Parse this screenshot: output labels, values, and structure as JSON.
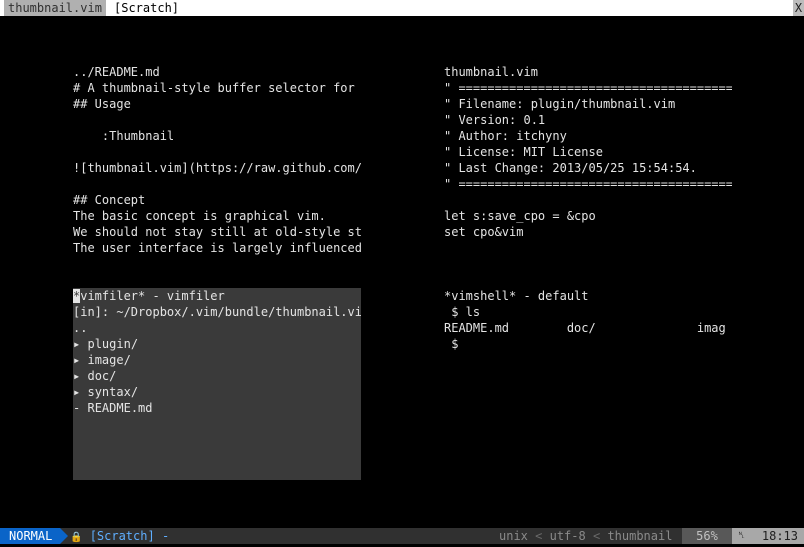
{
  "tabline": {
    "tabs": [
      {
        "label": "thumbnail.vim"
      },
      {
        "label": "[Scratch]"
      }
    ],
    "close_label": "X"
  },
  "thumbnails": [
    {
      "lines": [
        "../README.md",
        "# A thumbnail-style buffer selector for V",
        "## Usage",
        "",
        "    :Thumbnail",
        "",
        "![thumbnail.vim](https://raw.github.com/i",
        "",
        "## Concept",
        "The basic concept is graphical vim.",
        "We should not stay still at old-style sta",
        "The user interface is largely influenced"
      ]
    },
    {
      "lines": [
        "thumbnail.vim",
        "\" ======================================",
        "\" Filename: plugin/thumbnail.vim",
        "\" Version: 0.1",
        "\" Author: itchyny",
        "\" License: MIT License",
        "\" Last Change: 2013/05/25 15:54:54.",
        "\" ======================================",
        "",
        "let s:save_cpo = &cpo",
        "set cpo&vim"
      ]
    },
    {
      "cursor_char": "*",
      "first_line_rest": "vimfiler* - vimfiler",
      "lines": [
        "[in]: ~/Dropbox/.vim/bundle/thumbnail.vim",
        ".."
      ],
      "tree": [
        {
          "icon": "▸",
          "label": "plugin/"
        },
        {
          "icon": "▸",
          "label": "image/"
        },
        {
          "icon": "▸",
          "label": "doc/"
        },
        {
          "icon": "▸",
          "label": "syntax/"
        },
        {
          "icon": "-",
          "label": "README.md"
        }
      ]
    },
    {
      "lines": [
        "*vimshell* - default",
        " $ ls",
        "README.md        doc/              imag",
        " $"
      ]
    }
  ],
  "statusline": {
    "mode": "NORMAL",
    "buffer_icon": "🔒",
    "buffer_name": "[Scratch]",
    "buffer_suffix": "-",
    "fileformat": "unix",
    "encoding": "utf-8",
    "filetype": "thumbnail",
    "percent": "56%",
    "line_icon": "␤",
    "position": "18:13",
    "separator": "<"
  },
  "colors": {
    "mode_bg": "#0a64c8",
    "selected_bg": "#3a3a3a",
    "buffer_name": "#5fafff"
  }
}
